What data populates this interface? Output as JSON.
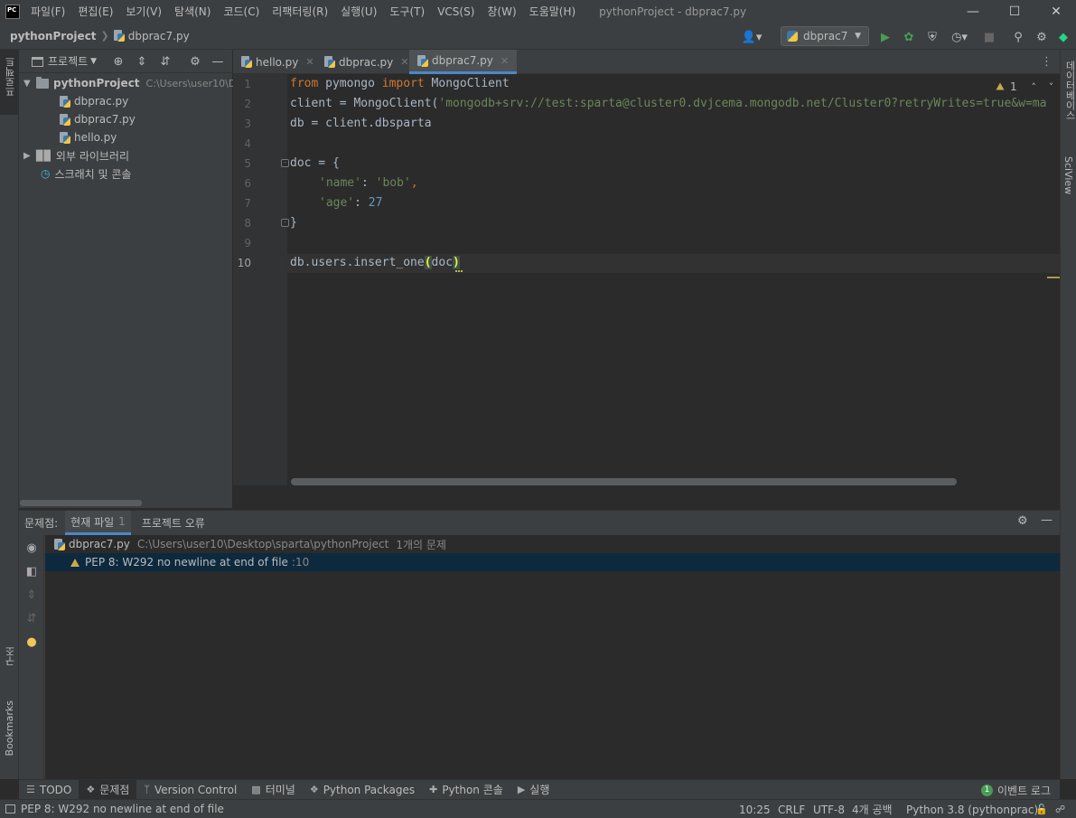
{
  "app": {
    "logo": "PC",
    "window_title": "pythonProject - dbprac7.py",
    "menus": [
      "파일(F)",
      "편집(E)",
      "보기(V)",
      "탐색(N)",
      "코드(C)",
      "리팩터링(R)",
      "실행(U)",
      "도구(T)",
      "VCS(S)",
      "창(W)",
      "도움말(H)"
    ]
  },
  "navbar": {
    "project": "pythonProject",
    "file": "dbprac7.py",
    "run_config": "dbprac7"
  },
  "left_stripe": {
    "project_label": "프로젝트",
    "structure_label": "구조",
    "bookmarks_label": "Bookmarks"
  },
  "right_stripe": {
    "database_label": "데이터베이스",
    "sciview_label": "SciView"
  },
  "project_panel": {
    "title": "프로젝트",
    "root_name": "pythonProject",
    "root_path": "C:\\Users\\user10\\D",
    "files": [
      "dbprac.py",
      "dbprac7.py",
      "hello.py"
    ],
    "external_libraries": "외부 라이브러리",
    "scratches": "스크래치 및 콘솔"
  },
  "tabs": [
    {
      "label": "hello.py"
    },
    {
      "label": "dbprac.py"
    },
    {
      "label": "dbprac7.py"
    }
  ],
  "editor": {
    "line_numbers": [
      "1",
      "2",
      "3",
      "4",
      "5",
      "6",
      "7",
      "8",
      "9",
      "10"
    ],
    "inspection_count": "1",
    "lines": {
      "l1_kw1": "from",
      "l1_mid": " pymongo ",
      "l1_kw2": "import",
      "l1_end": " MongoClient",
      "l2_pre": "client = MongoClient(",
      "l2_str": "'mongodb+srv://test:sparta@cluster0.dvjcema.mongodb.net/Cluster0?retryWrites=true&w=ma",
      "l3": "db = client.dbsparta",
      "l5": "doc = {",
      "l6_str1": "'name'",
      "l6_colon": ": ",
      "l6_str2": "'bob'",
      "l6_comma": ",",
      "l7_str": "'age'",
      "l7_colon": ": ",
      "l7_num": "27",
      "l8": "}",
      "l10_pre": "db.users.insert_one",
      "l10_open": "(",
      "l10_arg": "doc",
      "l10_close": ")"
    }
  },
  "problems": {
    "label": "문제점:",
    "tab_current": "현재 파일",
    "tab_current_count": "1",
    "tab_project": "프로젝트 오류",
    "file_name": "dbprac7.py",
    "file_path": "C:\\Users\\user10\\Desktop\\sparta\\pythonProject",
    "file_count": "1개의 문제",
    "issue_text": "PEP 8: W292 no newline at end of file",
    "issue_line": ":10"
  },
  "bottom_tools": [
    "TODO",
    "문제점",
    "Version Control",
    "터미널",
    "Python Packages",
    "Python 콘솔",
    "실행"
  ],
  "event_log": {
    "count": "1",
    "label": "이벤트 로그"
  },
  "status": {
    "message": "PEP 8: W292 no newline at end of file",
    "position": "10:25",
    "line_sep": "CRLF",
    "encoding": "UTF-8",
    "indent": "4개 공백",
    "interpreter": "Python 3.8 (pythonprac)"
  },
  "colors": {
    "background": "#2b2b2b",
    "panel": "#3c3f41",
    "keyword": "#cc7832",
    "string": "#6a8759",
    "number": "#6897bb",
    "accent": "#4a88c7",
    "run_green": "#499c54"
  }
}
